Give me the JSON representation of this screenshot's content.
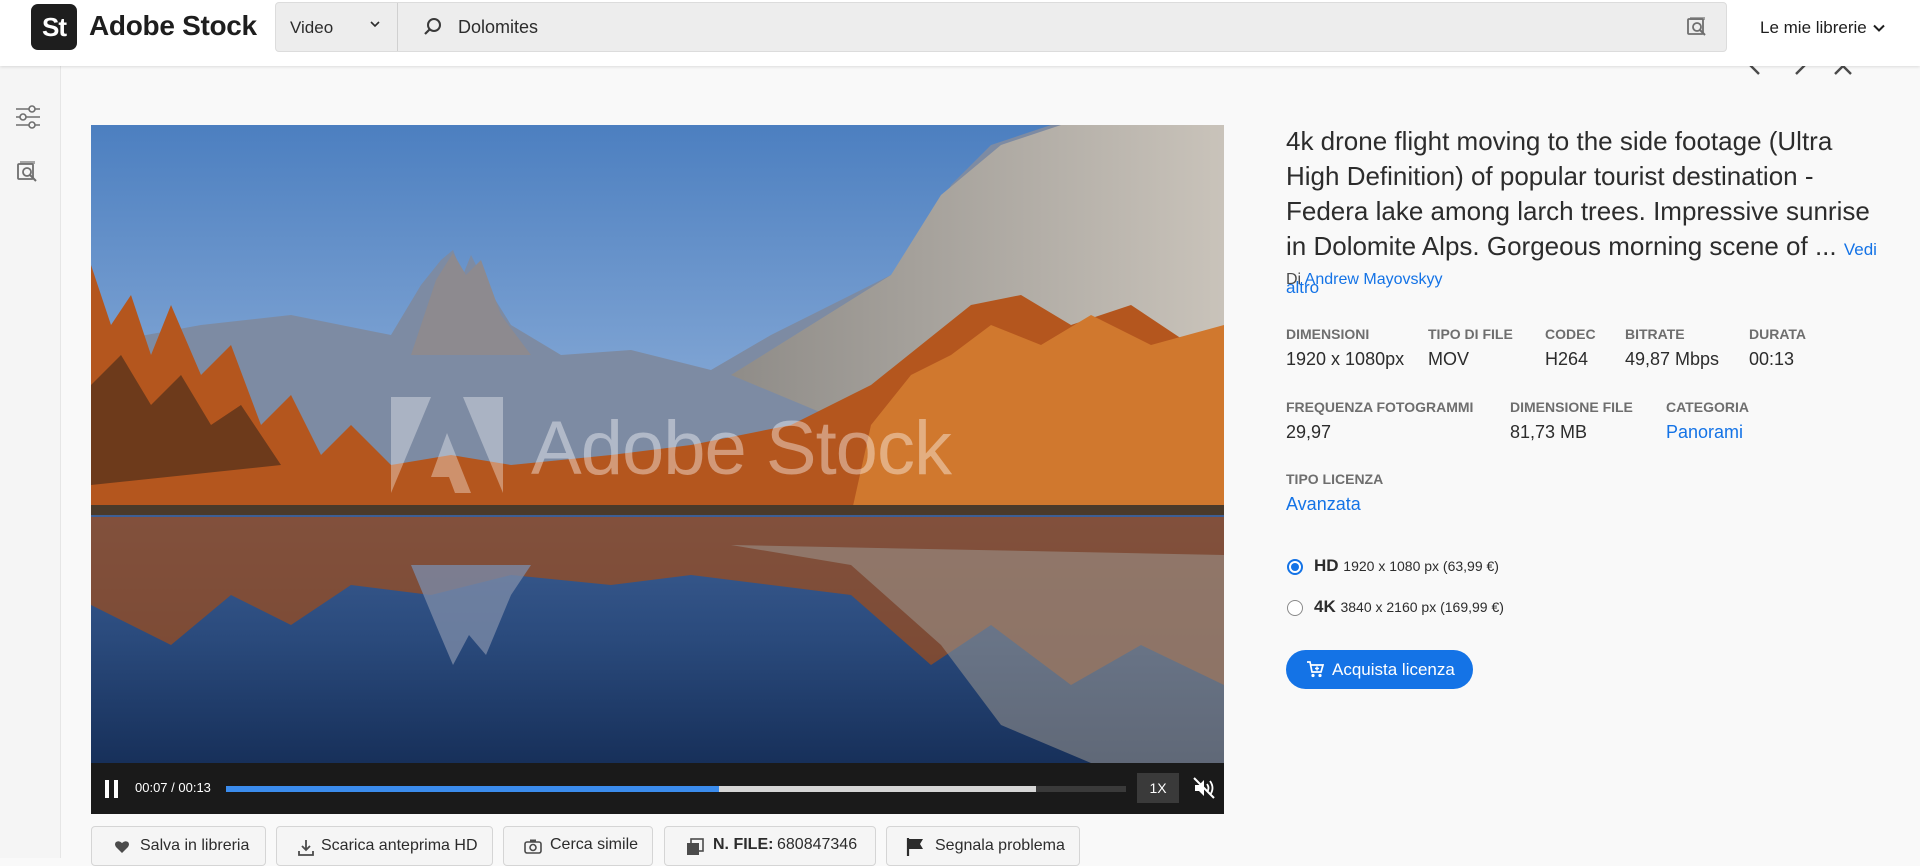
{
  "header": {
    "logo_mark": "St",
    "logo_text": "Adobe Stock",
    "type_select": "Video",
    "search_value": "Dolomites",
    "libraries_label": "Le mie librerie"
  },
  "player": {
    "watermark": "Adobe Stock",
    "time": "00:07 / 00:13",
    "progress_fraction": 0.548,
    "buffered_fraction": 0.9,
    "speed": "1X"
  },
  "actions": {
    "save": "Salva in libreria",
    "download": "Scarica anteprima HD",
    "similar": "Cerca simile",
    "file_label": "N. FILE:",
    "file_number": "680847346",
    "report": "Segnala problema"
  },
  "details": {
    "title": "4k drone flight moving to the side footage (Ultra High Definition) of popular tourist destination - Federa lake among larch trees. Impressive sunrise in Dolomite Alps. Gorgeous morning scene of ...",
    "see_more": "Vedi altro",
    "author_prefix": "Di",
    "author": "Andrew Mayovskyy",
    "specs": {
      "dimensions_label": "DIMENSIONI",
      "dimensions": "1920 x 1080px",
      "file_type_label": "TIPO DI FILE",
      "file_type": "MOV",
      "codec_label": "CODEC",
      "codec": "H264",
      "bitrate_label": "BITRATE",
      "bitrate": "49,87 Mbps",
      "duration_label": "DURATA",
      "duration": "00:13",
      "framerate_label": "FREQUENZA FOTOGRAMMI",
      "framerate": "29,97",
      "filesize_label": "DIMENSIONE FILE",
      "filesize": "81,73 MB",
      "category_label": "CATEGORIA",
      "category": "Panorami",
      "license_type_label": "TIPO LICENZA",
      "license_type": "Avanzata"
    },
    "options": [
      {
        "name": "HD",
        "detail": "1920 x 1080 px (63,99 €)",
        "selected": true
      },
      {
        "name": "4K",
        "detail": "3840 x 2160 px (169,99 €)",
        "selected": false
      }
    ],
    "buy_label": "Acquista licenza"
  },
  "colors": {
    "accent": "#1473e6",
    "progress": "#3b8ced"
  }
}
